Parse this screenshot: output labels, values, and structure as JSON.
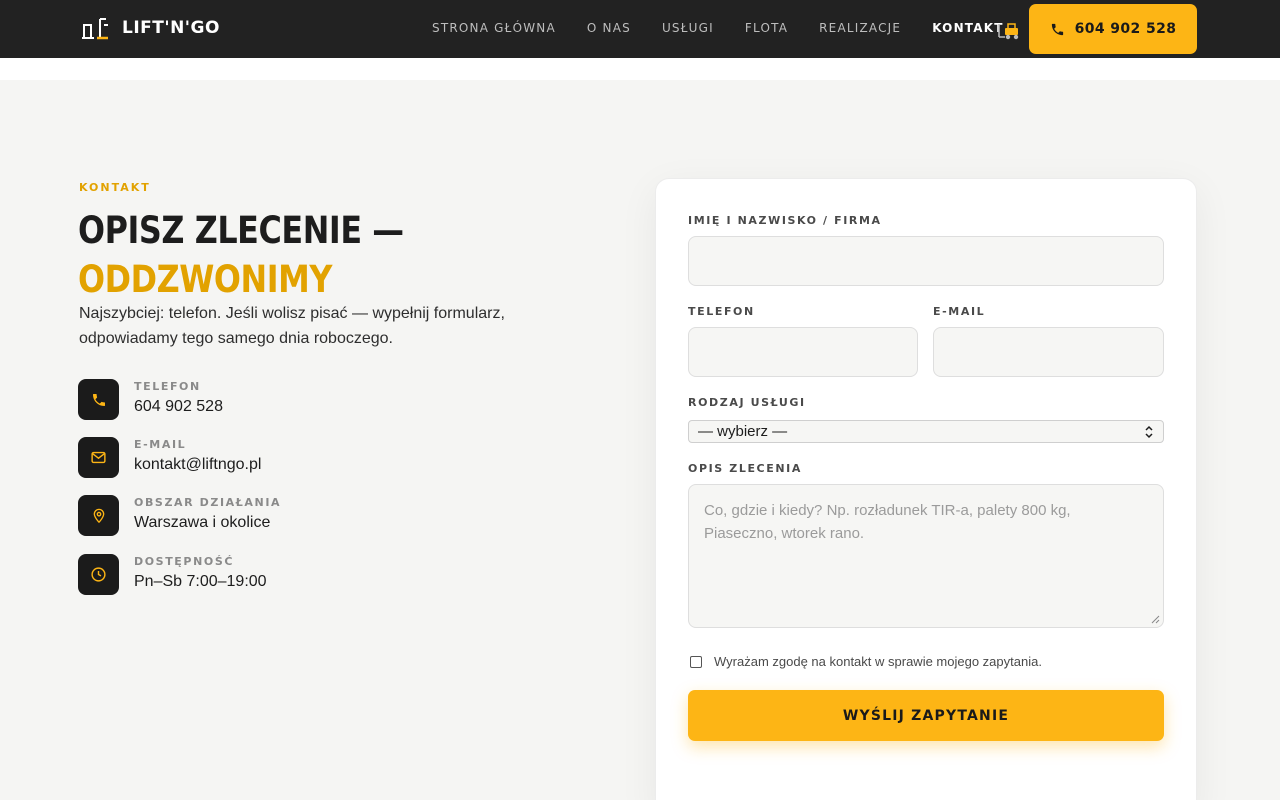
{
  "brand": {
    "name": "LIFT'N'GO"
  },
  "nav": {
    "items": [
      "STRONA GŁÓWNA",
      "O NAS",
      "USŁUGI",
      "FLOTA",
      "REALIZACJE",
      "KONTAKT"
    ],
    "active": "KONTAKT"
  },
  "header": {
    "phone_button": "604 902 528"
  },
  "section": {
    "eyebrow": "KONTAKT",
    "title_line1": "OPISZ ZLECENIE —",
    "title_line2": "ODDZWONIMY",
    "lead": "Najszybciej: telefon. Jeśli wolisz pisać — wypełnij formularz, odpowiadamy tego samego dnia roboczego."
  },
  "contacts": [
    {
      "label": "TELEFON",
      "value": "604 902 528",
      "icon": "phone-icon"
    },
    {
      "label": "E-MAIL",
      "value": "kontakt@liftngo.pl",
      "icon": "mail-icon"
    },
    {
      "label": "OBSZAR DZIAŁANIA",
      "value": "Warszawa i okolice",
      "icon": "location-pin-icon"
    },
    {
      "label": "DOSTĘPNOŚĆ",
      "value": "Pn–Sb 7:00–19:00",
      "icon": "clock-icon"
    }
  ],
  "form": {
    "name_label": "IMIĘ I NAZWISKO / FIRMA",
    "phone_label": "TELEFON",
    "email_label": "E-MAIL",
    "service_label": "RODZAJ USŁUGI",
    "service_selected": "— wybierz —",
    "description_label": "OPIS ZLECENIA",
    "description_placeholder": "Co, gdzie i kiedy? Np. rozładunek TIR-a, palety 800 kg, Piaseczno, wtorek rano.",
    "consent": "Wyrażam zgodę na kontakt w sprawie mojego zapytania.",
    "submit": "WYŚLIJ ZAPYTANIE"
  },
  "colors": {
    "accent": "#fdb515",
    "accent_text": "#e2a200",
    "dark": "#222222",
    "background": "#f5f5f3"
  }
}
